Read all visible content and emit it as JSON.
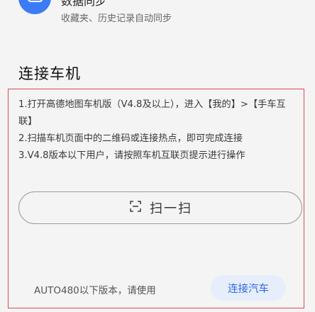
{
  "sync": {
    "title": "数据同步",
    "subtitle": "收藏夹、历史记录自动同步",
    "icon": "cloud-sync-icon"
  },
  "connect_section": {
    "title": "连接车机",
    "instructions": [
      "1.打开高德地图车机版（V4.8及以上），进入【我的】>【手车互联】",
      "2.扫描车机页面中的二维码或连接热点，即可完成连接",
      "3.V4.8版本以下用户，请按照车机互联页提示进行操作"
    ],
    "scan_button": {
      "label": "扫一扫",
      "icon": "scan-icon"
    },
    "footer_note": "AUTO480以下版本，请使用",
    "connect_button": "连接汽车"
  },
  "colors": {
    "accent": "#3b7cf6",
    "highlight_border": "#e04a4a",
    "connect_button_bg": "#e6eefc",
    "connect_button_text": "#3169e0"
  }
}
